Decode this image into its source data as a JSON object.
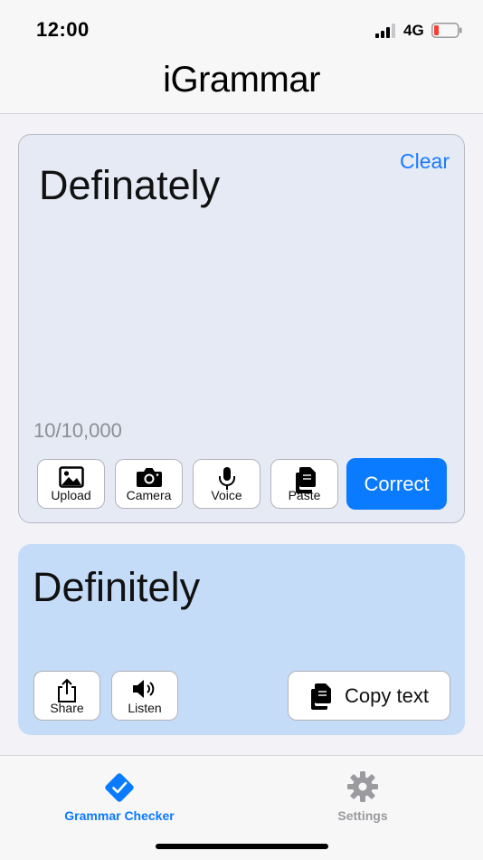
{
  "status": {
    "time": "12:00",
    "network": "4G"
  },
  "nav": {
    "title": "iGrammar"
  },
  "input": {
    "clear_label": "Clear",
    "text": "Definately",
    "char_count": "10/10,000",
    "tools": [
      {
        "label": "Upload",
        "icon": "image-icon"
      },
      {
        "label": "Camera",
        "icon": "camera-icon"
      },
      {
        "label": "Voice",
        "icon": "microphone-icon"
      },
      {
        "label": "Paste",
        "icon": "paste-icon"
      }
    ],
    "correct_label": "Correct"
  },
  "output": {
    "text": "Definitely",
    "share_label": "Share",
    "listen_label": "Listen",
    "copy_label": "Copy text"
  },
  "tabs": [
    {
      "label": "Grammar Checker",
      "icon": "checkmark-diamond-icon",
      "active": true
    },
    {
      "label": "Settings",
      "icon": "gear-icon",
      "active": false
    }
  ],
  "colors": {
    "accent": "#0a7aff",
    "input_bg": "#e5eaf5",
    "output_bg": "#c5dcf8",
    "inactive_tab": "#9a9a9f",
    "battery_low": "#ff3b30"
  }
}
